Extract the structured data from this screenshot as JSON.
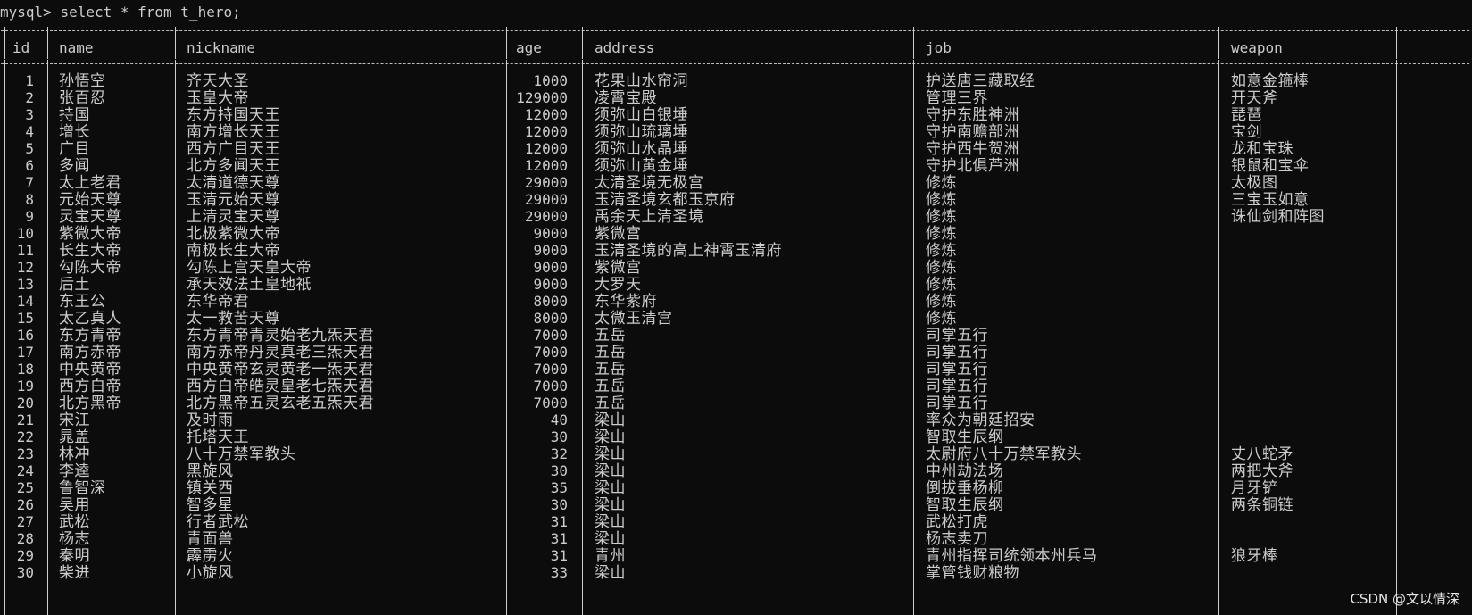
{
  "terminal": {
    "prompt": "mysql> ",
    "command": "select * from t_hero;",
    "watermark": "CSDN @文以情深"
  },
  "table": {
    "columns": [
      "id",
      "name",
      "nickname",
      "age",
      "address",
      "job",
      "weapon"
    ],
    "rows": [
      [
        "1",
        "孙悟空",
        "齐天大圣",
        "1000",
        "花果山水帘洞",
        "护送唐三藏取经",
        "如意金箍棒"
      ],
      [
        "2",
        "张百忍",
        "玉皇大帝",
        "129000",
        "凌霄宝殿",
        "管理三界",
        "开天斧"
      ],
      [
        "3",
        "持国",
        "东方持国天王",
        "12000",
        "须弥山白银埵",
        "守护东胜神洲",
        "琵琶"
      ],
      [
        "4",
        "增长",
        "南方增长天王",
        "12000",
        "须弥山琉璃埵",
        "守护南赡部洲",
        "宝剑"
      ],
      [
        "5",
        "广目",
        "西方广目天王",
        "12000",
        "须弥山水晶埵",
        "守护西牛贺洲",
        "龙和宝珠"
      ],
      [
        "6",
        "多闻",
        "北方多闻天王",
        "12000",
        "须弥山黄金埵",
        "守护北俱芦洲",
        "银鼠和宝伞"
      ],
      [
        "7",
        "太上老君",
        "太清道德天尊",
        "29000",
        "太清圣境无极宫",
        "修炼",
        "太极图"
      ],
      [
        "8",
        "元始天尊",
        "玉清元始天尊",
        "29000",
        "玉清圣境玄都玉京府",
        "修炼",
        "三宝玉如意"
      ],
      [
        "9",
        "灵宝天尊",
        "上清灵宝天尊",
        "29000",
        "禹余天上清圣境",
        "修炼",
        "诛仙剑和阵图"
      ],
      [
        "10",
        "紫微大帝",
        "北极紫微大帝",
        "9000",
        "紫微宫",
        "修炼",
        ""
      ],
      [
        "11",
        "长生大帝",
        "南极长生大帝",
        "9000",
        "玉清圣境的高上神霄玉清府",
        "修炼",
        ""
      ],
      [
        "12",
        "勾陈大帝",
        "勾陈上宫天皇大帝",
        "9000",
        "紫微宫",
        "修炼",
        ""
      ],
      [
        "13",
        "后土",
        "承天效法土皇地祇",
        "9000",
        "大罗天",
        "修炼",
        ""
      ],
      [
        "14",
        "东王公",
        "东华帝君",
        "8000",
        "东华紫府",
        "修炼",
        ""
      ],
      [
        "15",
        "太乙真人",
        "太一救苦天尊",
        "8000",
        "太微玉清宫",
        "修炼",
        ""
      ],
      [
        "16",
        "东方青帝",
        "东方青帝青灵始老九炁天君",
        "7000",
        "五岳",
        "司掌五行",
        ""
      ],
      [
        "17",
        "南方赤帝",
        "南方赤帝丹灵真老三炁天君",
        "7000",
        "五岳",
        "司掌五行",
        ""
      ],
      [
        "18",
        "中央黄帝",
        "中央黄帝玄灵黄老一炁天君",
        "7000",
        "五岳",
        "司掌五行",
        ""
      ],
      [
        "19",
        "西方白帝",
        "西方白帝皓灵皇老七炁天君",
        "7000",
        "五岳",
        "司掌五行",
        ""
      ],
      [
        "20",
        "北方黑帝",
        "北方黑帝五灵玄老五炁天君",
        "7000",
        "五岳",
        "司掌五行",
        ""
      ],
      [
        "21",
        "宋江",
        "及时雨",
        "40",
        "梁山",
        "率众为朝廷招安",
        ""
      ],
      [
        "22",
        "晁盖",
        "托塔天王",
        "30",
        "梁山",
        "智取生辰纲",
        ""
      ],
      [
        "23",
        "林冲",
        "八十万禁军教头",
        "32",
        "梁山",
        "太尉府八十万禁军教头",
        "丈八蛇矛"
      ],
      [
        "24",
        "李逵",
        "黑旋风",
        "30",
        "梁山",
        "中州劫法场",
        "两把大斧"
      ],
      [
        "25",
        "鲁智深",
        "镇关西",
        "35",
        "梁山",
        "倒拔垂杨柳",
        "月牙铲"
      ],
      [
        "26",
        "吴用",
        "智多星",
        "30",
        "梁山",
        "智取生辰纲",
        "两条铜链"
      ],
      [
        "27",
        "武松",
        "行者武松",
        "31",
        "梁山",
        "武松打虎",
        ""
      ],
      [
        "28",
        "杨志",
        "青面兽",
        "31",
        "梁山",
        "杨志卖刀",
        ""
      ],
      [
        "29",
        "秦明",
        "霹雳火",
        "31",
        "青州",
        "青州指挥司统领本州兵马",
        "狼牙棒"
      ],
      [
        "30",
        "柴进",
        "小旋风",
        "33",
        "梁山",
        "掌管钱财粮物",
        ""
      ]
    ]
  }
}
